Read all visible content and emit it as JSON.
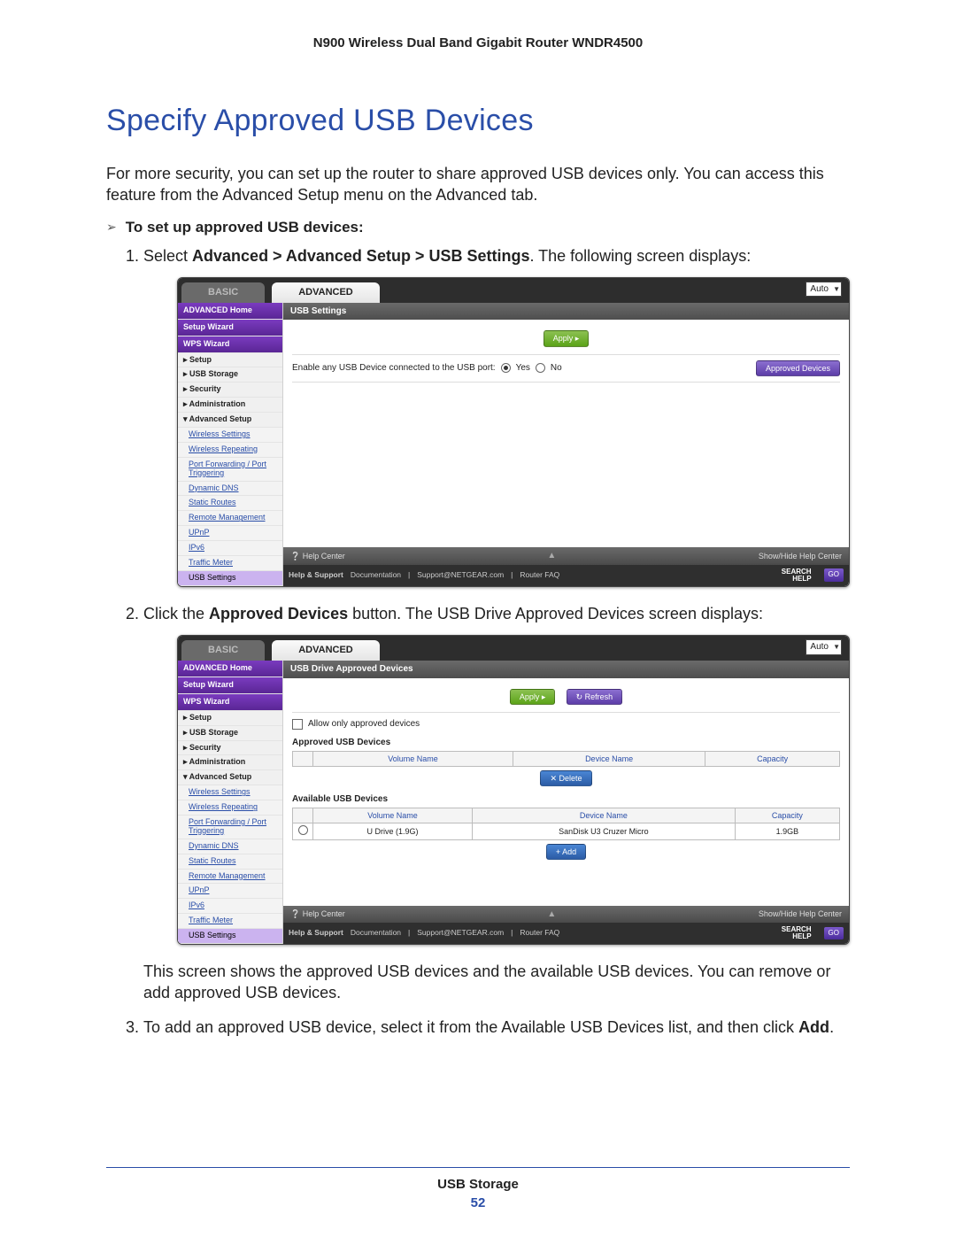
{
  "doc": {
    "running_head": "N900 Wireless Dual Band Gigabit Router WNDR4500",
    "section_title": "Specify Approved USB Devices",
    "intro": "For more security, you can set up the router to share approved USB devices only. You can access this feature from the Advanced Setup menu on the Advanced tab.",
    "task_heading": "To set up approved USB devices:",
    "step1_pre": "Select ",
    "step1_bold": "Advanced > Advanced Setup > USB Settings",
    "step1_post": ". The following screen displays:",
    "step2_pre": "Click the ",
    "step2_bold": "Approved Devices",
    "step2_post": " button. The USB Drive Approved Devices screen displays:",
    "step2_followup": "This screen shows the approved USB devices and the available USB devices. You can remove or add approved USB devices.",
    "step3_pre": "To add an approved USB device, select it from the Available USB Devices list, and then click ",
    "step3_bold": "Add",
    "step3_post": ".",
    "footer_label": "USB Storage",
    "page_number": "52"
  },
  "ui": {
    "tabs": {
      "basic": "BASIC",
      "advanced": "ADVANCED",
      "auto": "Auto"
    },
    "sidebar_main": [
      "ADVANCED Home",
      "Setup Wizard",
      "WPS Wizard"
    ],
    "sidebar_top": [
      "▸ Setup",
      "▸ USB Storage",
      "▸ Security",
      "▸ Administration",
      "▾ Advanced Setup"
    ],
    "sidebar_sub": [
      "Wireless Settings",
      "Wireless Repeating",
      "Port Forwarding / Port Triggering",
      "Dynamic DNS",
      "Static Routes",
      "Remote Management",
      "UPnP",
      "IPv6",
      "Traffic Meter",
      "USB Settings"
    ],
    "pane1": {
      "title": "USB Settings",
      "apply": "Apply ▸",
      "enable_label": "Enable any USB Device connected to the USB port:",
      "yes": "Yes",
      "no": "No",
      "approved_btn": "Approved Devices"
    },
    "pane2": {
      "title": "USB Drive Approved Devices",
      "apply": "Apply ▸",
      "refresh": "↻ Refresh",
      "allow_only": "Allow only approved devices",
      "approved_label": "Approved USB Devices",
      "available_label": "Available USB Devices",
      "col_volume": "Volume Name",
      "col_device": "Device Name",
      "col_capacity": "Capacity",
      "delete_btn": "✕ Delete",
      "add_btn": "+ Add",
      "row_volume": "U Drive (1.9G)",
      "row_device": "SanDisk U3 Cruzer Micro",
      "row_capacity": "1.9GB"
    },
    "help_strip": {
      "help_center": "❔ Help Center",
      "show_hide": "Show/Hide Help Center"
    },
    "support": {
      "label": "Help & Support",
      "doc": "Documentation",
      "email": "Support@NETGEAR.com",
      "faq": "Router FAQ",
      "search": "SEARCH",
      "help": "HELP",
      "go": "GO"
    }
  }
}
